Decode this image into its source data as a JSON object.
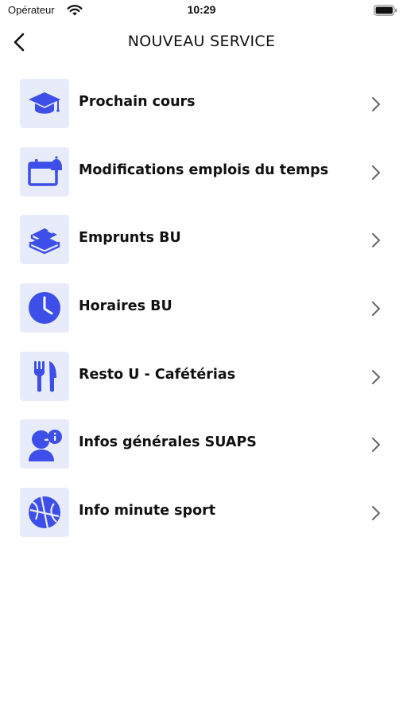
{
  "status_bar": {
    "carrier": "Opérateur",
    "time": "10:29"
  },
  "nav": {
    "title": "NOUVEAU SERVICE"
  },
  "accent_color": "#3d4fe8",
  "tile_color": "#e8ecfa",
  "services": [
    {
      "label": "Prochain cours",
      "icon": "graduation-cap-icon"
    },
    {
      "label": "Modifications emplois du temps",
      "icon": "calendar-bell-icon"
    },
    {
      "label": "Emprunts BU",
      "icon": "books-icon"
    },
    {
      "label": "Horaires BU",
      "icon": "clock-icon"
    },
    {
      "label": "Resto U - Cafétérias",
      "icon": "fork-knife-icon"
    },
    {
      "label": "Infos générales SUAPS",
      "icon": "user-info-icon"
    },
    {
      "label": "Info minute sport",
      "icon": "basketball-icon"
    }
  ]
}
